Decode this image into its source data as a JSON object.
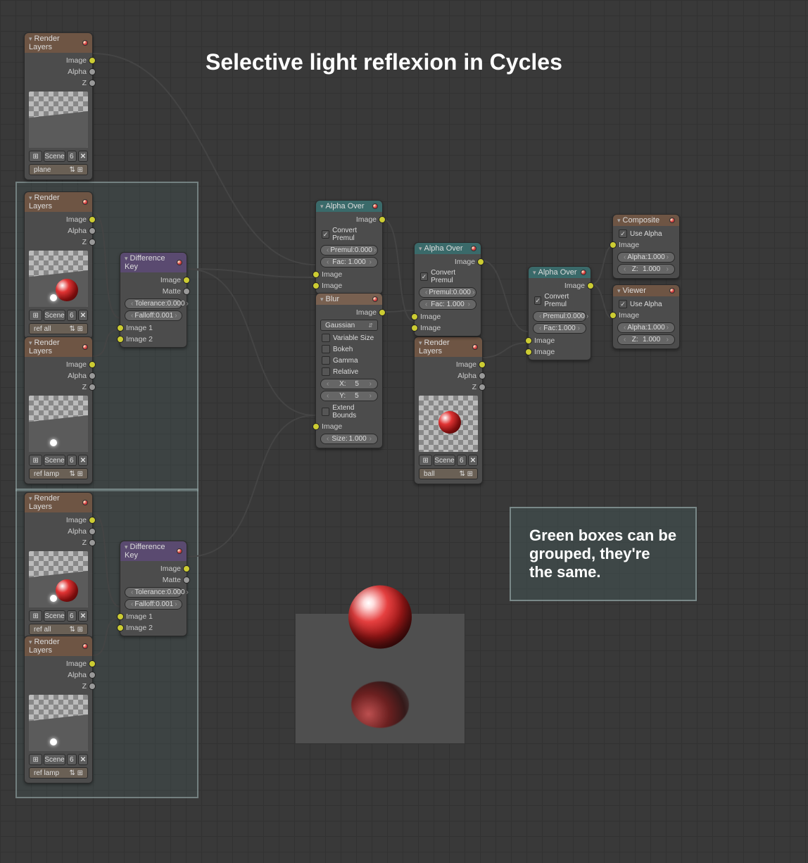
{
  "title": "Selective light reflexion in Cycles",
  "note": "Green boxes can be grouped, they're the same.",
  "labels": {
    "renderLayers": "Render Layers",
    "image": "Image",
    "alpha": "Alpha",
    "z": "Z",
    "matte": "Matte",
    "scene": "Scene",
    "fac": "Fac:",
    "alphaColon": "Alpha:",
    "zColon": "Z:"
  },
  "layerNames": {
    "plane": "plane",
    "refAll": "ref all",
    "refLamp": "ref lamp",
    "ball": "ball"
  },
  "sceneCount": "6",
  "diffKey": {
    "title": "Difference Key",
    "tolerance": "Tolerance:",
    "toleranceVal": "0.000",
    "falloff": "Falloff:",
    "falloffVal": "0.001",
    "image1": "Image 1",
    "image2": "Image 2"
  },
  "alphaOver": {
    "title": "Alpha Over",
    "convertPremul": "Convert Premul",
    "premul": "Premul:",
    "premulVal": "0.000",
    "facVal": "1.000"
  },
  "blur": {
    "title": "Blur",
    "gaussian": "Gaussian",
    "variableSize": "Variable Size",
    "bokeh": "Bokeh",
    "gamma": "Gamma",
    "relative": "Relative",
    "x": "X:",
    "xVal": "5",
    "y": "Y:",
    "yVal": "5",
    "extend": "Extend Bounds",
    "size": "Size:",
    "sizeVal": "1.000"
  },
  "composite": {
    "title": "Composite",
    "useAlpha": "Use Alpha",
    "alphaVal": "1.000",
    "zVal": "1.000"
  },
  "viewer": {
    "title": "Viewer"
  }
}
